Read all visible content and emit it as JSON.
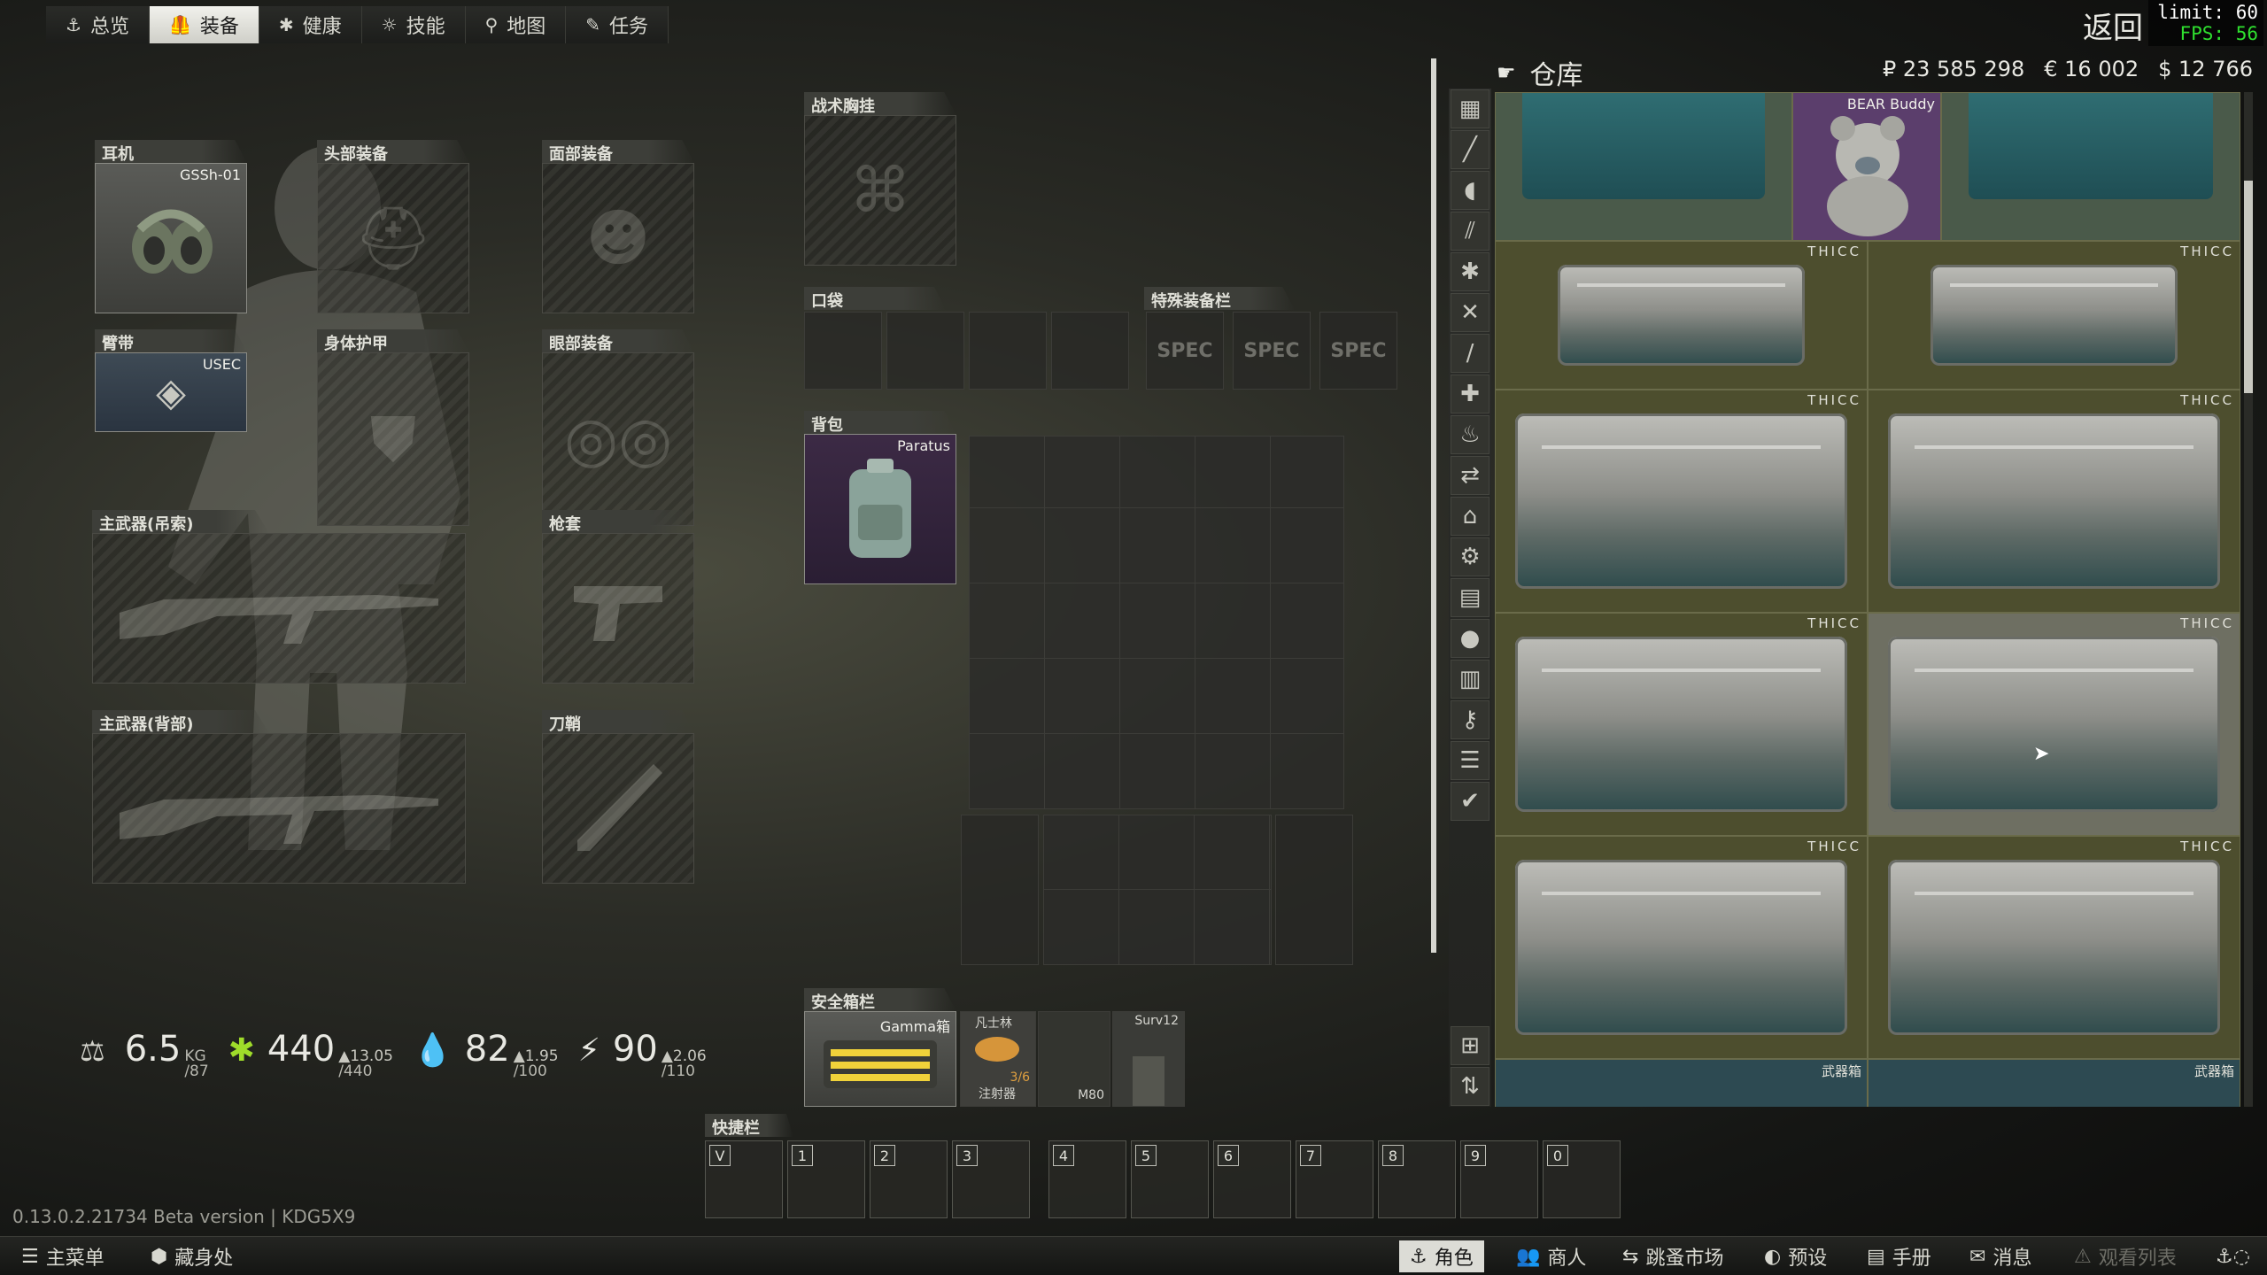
{
  "nav": {
    "tabs": [
      {
        "label": "总览",
        "icon": "anchor-icon"
      },
      {
        "label": "装备",
        "icon": "gear-vest-icon"
      },
      {
        "label": "健康",
        "icon": "health-icon"
      },
      {
        "label": "技能",
        "icon": "skills-icon"
      },
      {
        "label": "地图",
        "icon": "map-pin-icon"
      },
      {
        "label": "任务",
        "icon": "tasks-icon"
      }
    ],
    "active": "装备",
    "return_label": "返回"
  },
  "perf": {
    "limit": "limit: 60",
    "fps": "FPS: 56"
  },
  "equipment": {
    "earpiece": {
      "title": "耳机",
      "item": "GSSh-01"
    },
    "headwear": {
      "title": "头部装备"
    },
    "facecover": {
      "title": "面部装备"
    },
    "armband": {
      "title": "臂带",
      "item": "USEC"
    },
    "body_armor": {
      "title": "身体护甲"
    },
    "eyewear": {
      "title": "眼部装备"
    },
    "primary_sling": {
      "title": "主武器(吊索)"
    },
    "holster": {
      "title": "枪套"
    },
    "primary_back": {
      "title": "主武器(背部)"
    },
    "scabbard": {
      "title": "刀鞘"
    },
    "tactical_rig": {
      "title": "战术胸挂"
    },
    "pockets": {
      "title": "口袋"
    },
    "special": {
      "title": "特殊装备栏",
      "slots": [
        "SPEC",
        "SPEC",
        "SPEC"
      ]
    },
    "backpack": {
      "title": "背包",
      "item": "Paratus"
    },
    "secure": {
      "title": "安全箱栏",
      "item": "Gamma箱",
      "contents": [
        {
          "top": "凡士林",
          "count": "3/6",
          "bottom": "注射器"
        },
        {
          "top": "",
          "bottom": "M80"
        },
        {
          "top": "Surv12",
          "bottom": ""
        }
      ]
    }
  },
  "stats": {
    "weight": {
      "value": "6.5",
      "unit": "KG",
      "max": "/87"
    },
    "health": {
      "value": "440",
      "max": "/440",
      "delta": "▲13.05"
    },
    "hydration": {
      "value": "82",
      "max": "/100",
      "delta": "▲1.95"
    },
    "energy": {
      "value": "90",
      "max": "/110",
      "delta": "▲2.06"
    }
  },
  "stash": {
    "title": "仓库",
    "rubles": "₽ 23 585 298",
    "euros": "€ 16 002",
    "dollars": "$ 12 766",
    "bear_label": "BEAR Buddy",
    "case_label": "THICC",
    "weapon_case_label": "武器箱"
  },
  "quickbar": {
    "title": "快捷栏",
    "keys": [
      "V",
      "1",
      "2",
      "3",
      "4",
      "5",
      "6",
      "7",
      "8",
      "9",
      "0"
    ]
  },
  "version": "0.13.0.2.21734 Beta version | KDG5X9",
  "bottombar": {
    "main_menu": "主菜单",
    "hideout": "藏身处",
    "character": "角色",
    "traders": "商人",
    "flea": "跳蚤市场",
    "presets": "预设",
    "handbook": "手册",
    "messages": "消息",
    "watchlist": "观看列表"
  }
}
